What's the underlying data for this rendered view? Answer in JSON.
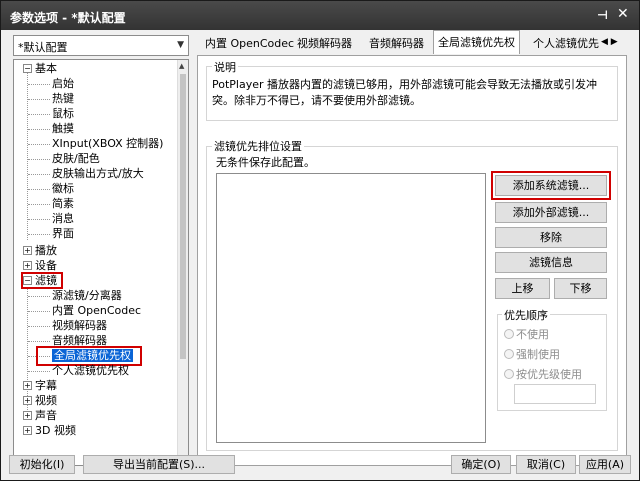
{
  "window": {
    "title": "参数选项 - *默认配置",
    "pin_icon": "pin-icon",
    "close_icon": "close-icon"
  },
  "preset": {
    "selected": "*默认配置"
  },
  "tree": {
    "basic": {
      "label": "基本",
      "children": [
        "启始",
        "热键",
        "鼠标",
        "触摸",
        "XInput(XBOX 控制器)",
        "皮肤/配色",
        "皮肤输出方式/放大",
        "徽标",
        "简素",
        "消息",
        "界面"
      ]
    },
    "playback": {
      "label": "播放"
    },
    "device": {
      "label": "设备"
    },
    "filters": {
      "label": "滤镜",
      "children": [
        "源滤镜/分离器",
        "内置 OpenCodec",
        "视频解码器",
        "音频解码器",
        "全局滤镜优先权",
        "个人滤镜优先权"
      ]
    },
    "subtitle": {
      "label": "字幕"
    },
    "video": {
      "label": "视频"
    },
    "audio": {
      "label": "声音"
    },
    "more": {
      "label": "3D 视频"
    }
  },
  "tabs": [
    "内置 OpenCodec",
    "视频解码器",
    "音频解码器",
    "全局滤镜优先权",
    "个人滤镜优先"
  ],
  "description": {
    "heading": "说明",
    "line1": "PotPlayer 播放器内置的滤镜已够用，用外部滤镜可能会导致无法播放或引发冲",
    "line2": "突。除非万不得已，请不要使用外部滤镜。"
  },
  "priority": {
    "heading": "滤镜优先排位设置",
    "note": "无条件保存此配置。",
    "buttons": {
      "add_system": "添加系统滤镜...",
      "add_external": "添加外部滤镜...",
      "remove": "移除",
      "info": "滤镜信息",
      "up": "上移",
      "down": "下移"
    },
    "order": {
      "heading": "优先顺序",
      "options": [
        "不使用",
        "强制使用",
        "按优先级使用"
      ]
    }
  },
  "bottom": {
    "init": "初始化(I)",
    "export": "导出当前配置(S)...",
    "ok": "确定(O)",
    "cancel": "取消(C)",
    "apply": "应用(A)"
  },
  "colors": {
    "highlight": "#0a64d6",
    "callout": "#d00000"
  }
}
